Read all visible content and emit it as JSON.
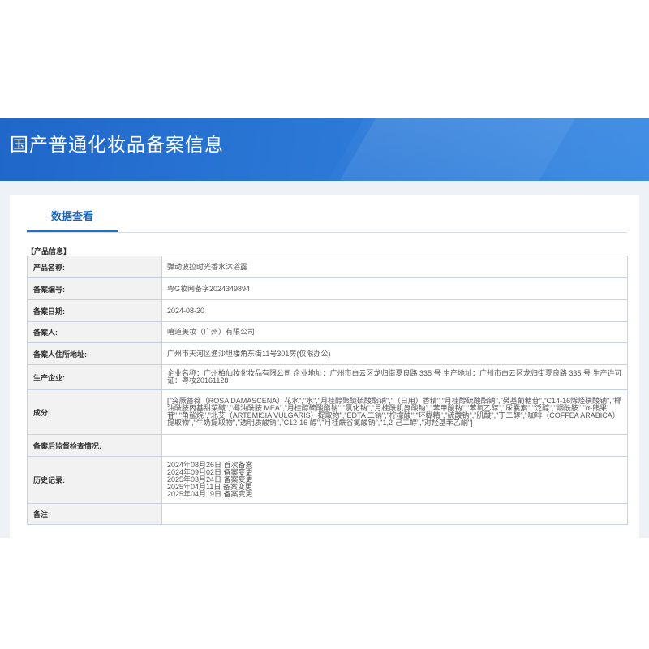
{
  "banner": {
    "title": "国产普通化妆品备案信息"
  },
  "tab": {
    "label": "数据查看"
  },
  "section": {
    "label": "【产品信息】"
  },
  "fields": {
    "product_name": {
      "key": "产品名称:",
      "value": "弹动波拉时光香水沐浴露"
    },
    "record_no": {
      "key": "备案编号:",
      "value": "粤G妆网备字2024349894"
    },
    "record_date": {
      "key": "备案日期:",
      "value": "2024-08-20"
    },
    "registrant": {
      "key": "备案人:",
      "value": "嘻道美妆（广州）有限公司"
    },
    "registrant_address": {
      "key": "备案人住所地址:",
      "value": "广州市天河区渔沙坦楼角东街11号301房(仅限办公)"
    },
    "manufacturer": {
      "key": "生产企业:",
      "value": "企业名称：广州柏仙妆化妆品有限公司 企业地址：广州市白云区龙归街夏良路 335 号 生产地址：广州市白云区龙归街夏良路 335 号 生产许可证：粤妆20161128"
    },
    "ingredients": {
      "key": "成分:",
      "value": "[\"突厥蔷薇（ROSA DAMASCENA）花水\",\"水\",\"月桂醇聚醚硫酸酯钠\",\"（日用）香精\",\"月桂醇硫酸酯钠\",\"癸基葡糖苷\",\"C14-16烯烃磺酸钠\",\"椰油酰胺丙基甜菜碱\",\"椰油酰胺 MEA\",\"月桂醇硫酸酯钠\",\"氯化钠\",\"月桂酰肌氨酸钠\",\"苯甲酸钠\",\"苯氧乙醇\",\"尿囊素\",\"泛醇\",\"烟酰胺\",\"α-熊果苷\",\"角鲨烷\",\"北艾（ARTEMISIA VULGARIS）提取物\",\"EDTA 二钠\",\"柠檬酸\",\"环糊精\",\"硫酸钠\",\"肌酸\",\"丁二醇\",\"咖啡（COFFEA ARABICA）提取物\",\"牛奶提取物\",\"透明质酸钠\",\"C12-16 醇\",\"月桂酰谷氨酸钠\",\"1,2-己二醇\",\"对羟基苯乙酮\"]"
    },
    "supervision": {
      "key": "备案后监督检查情况:",
      "value": ""
    },
    "history": {
      "key": "历史记录:",
      "lines": [
        "2024年08月26日 首次备案",
        "2024年09月02日 备案变更",
        "2025年03月24日 备案变更",
        "2025年04月11日 备案变更",
        "2025年04月19日 备案变更"
      ]
    },
    "remarks": {
      "key": "备注:",
      "value": ""
    }
  }
}
